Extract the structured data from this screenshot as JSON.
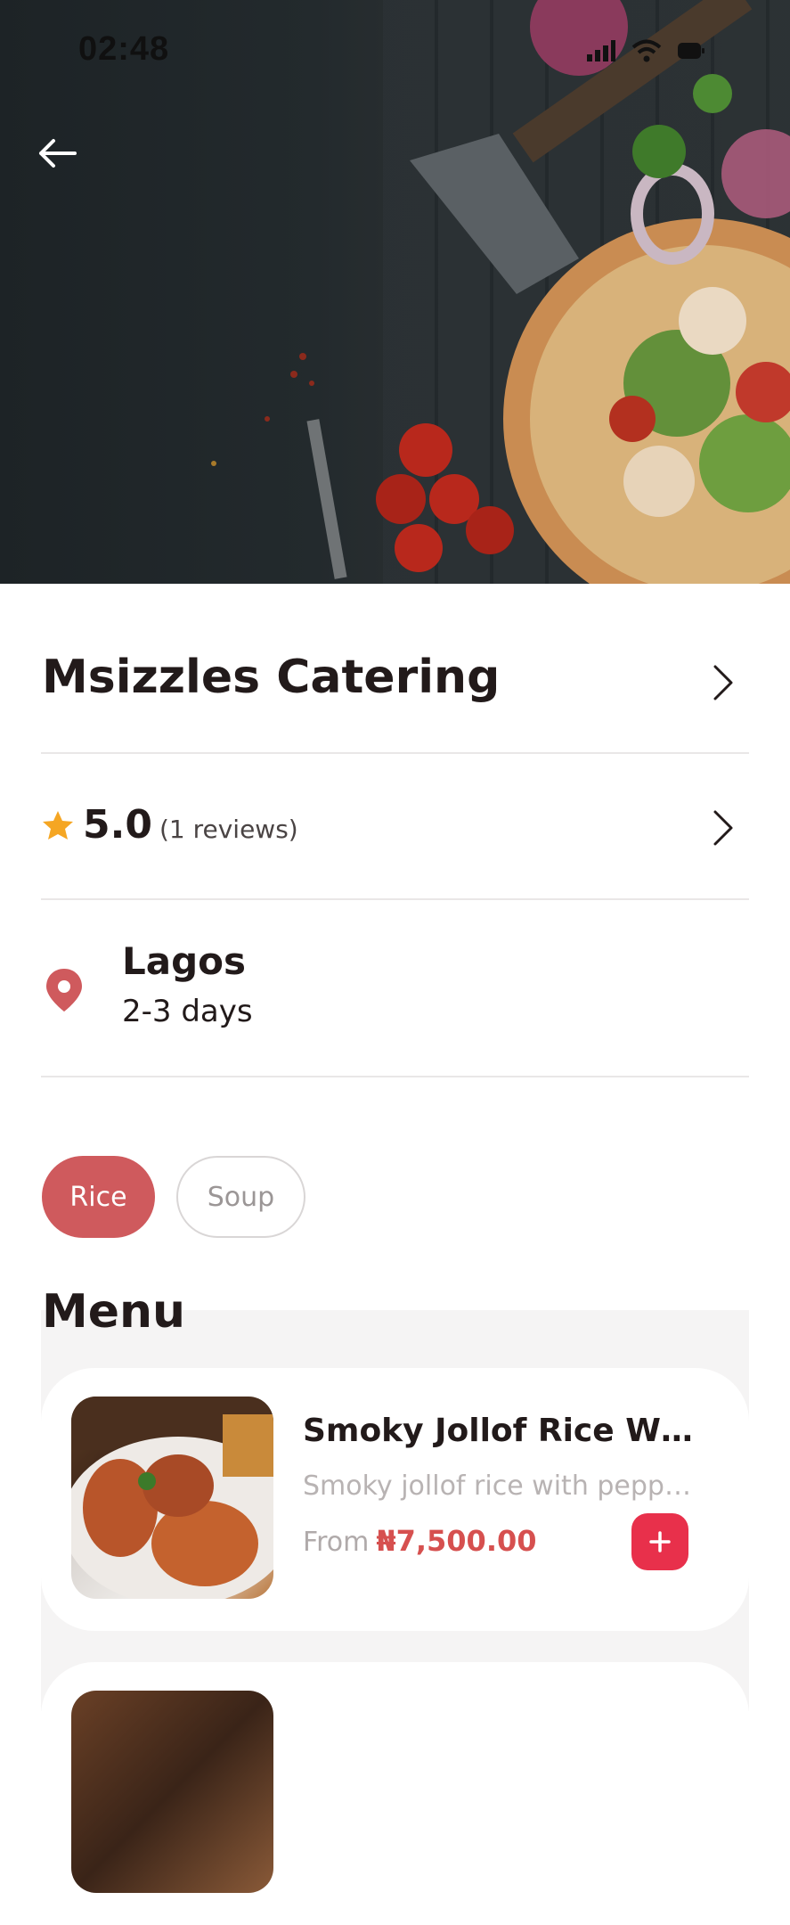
{
  "status_bar": {
    "time": "02:48"
  },
  "vendor": {
    "name": "Msizzles Catering",
    "rating": "5.0",
    "review_count": "(1 reviews)",
    "city": "Lagos",
    "delivery_time": "2-3 days"
  },
  "categories": [
    {
      "label": "Rice",
      "active": true
    },
    {
      "label": "Soup",
      "active": false
    }
  ],
  "menu": {
    "title": "Menu",
    "items": [
      {
        "name": "Smoky Jollof Rice With C...",
        "description": "Smoky jollof rice with peppe...",
        "price_prefix": "From",
        "price": "₦7,500.00"
      }
    ]
  },
  "colors": {
    "accent": "#cf5a5d",
    "add_button": "#e8304b",
    "price": "#d6504f",
    "star": "#f5a623"
  },
  "icons": [
    "back-arrow-icon",
    "chevron-right-icon",
    "star-icon",
    "location-pin-icon",
    "plus-icon",
    "signal-icon",
    "wifi-icon",
    "battery-icon"
  ]
}
